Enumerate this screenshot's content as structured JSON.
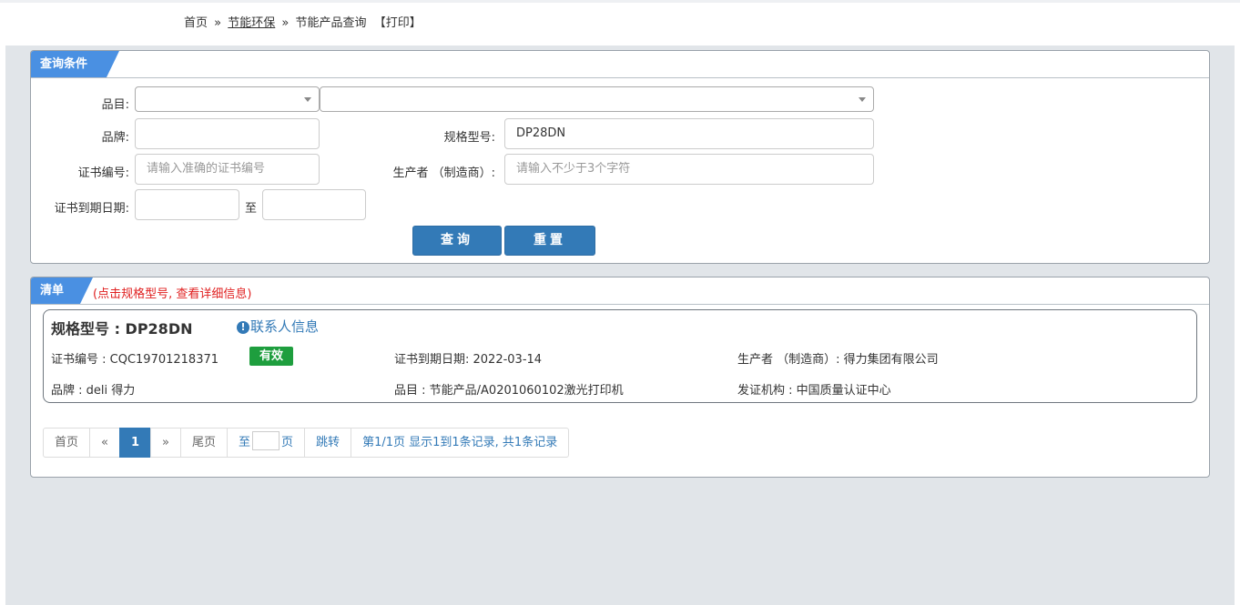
{
  "breadcrumb": {
    "home": "首页",
    "sep": "»",
    "section": "节能环保",
    "current": "节能产品查询",
    "print": "【打印】"
  },
  "query_panel": {
    "title": "查询条件",
    "category_label": "品目:",
    "brand_label": "品牌:",
    "model_label": "规格型号:",
    "model_value": "DP28DN",
    "cert_no_label": "证书编号:",
    "cert_no_placeholder": "请输入准确的证书编号",
    "manufacturer_label": "生产者 （制造商）:",
    "manufacturer_placeholder": "请输入不少于3个字符",
    "expiry_label": "证书到期日期:",
    "to_label": "至",
    "search_button": "查询",
    "reset_button": "重置"
  },
  "list_panel": {
    "title": "清单",
    "tip": "(点击规格型号, 查看详细信息)",
    "item": {
      "model_title": "规格型号 : DP28DN",
      "contact_link": "联系人信息",
      "cert_no": "证书编号 : CQC19701218371",
      "status": "有效",
      "expiry": "证书到期日期: 2022-03-14",
      "manufacturer": "生产者 （制造商）: 得力集团有限公司",
      "brand": "品牌 : deli 得力",
      "category": "品目 : 节能产品/A0201060102激光打印机",
      "issuer": "发证机构 : 中国质量认证中心"
    },
    "status_color": "#1e9e3e"
  },
  "pagination": {
    "first": "首页",
    "prev": "«",
    "current": "1",
    "next": "»",
    "last": "尾页",
    "goto_prefix": "至",
    "goto_suffix": "页",
    "jump": "跳转",
    "summary": "第1/1页  显示1到1条记录, 共1条记录"
  },
  "colors": {
    "accent": "#337ab7",
    "tab": "#4a90e2",
    "tip": "#e02020",
    "background": "#e1e5e9"
  }
}
